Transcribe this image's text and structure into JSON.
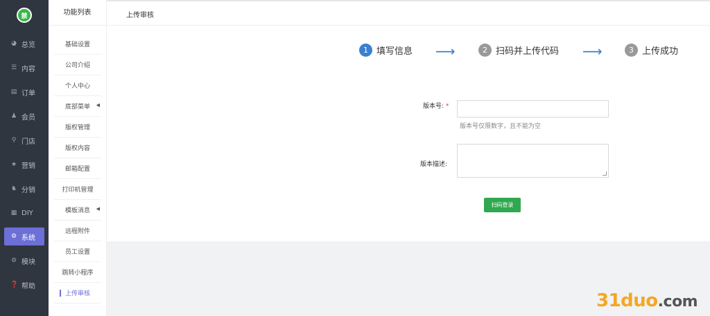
{
  "logo": {
    "text": "禁"
  },
  "nav": {
    "items": [
      {
        "label": "总览",
        "icon": "pie-chart-icon",
        "glyph": "◕"
      },
      {
        "label": "内容",
        "icon": "list-icon",
        "glyph": "☰"
      },
      {
        "label": "订单",
        "icon": "order-icon",
        "glyph": "▤"
      },
      {
        "label": "会员",
        "icon": "user-icon",
        "glyph": "♟"
      },
      {
        "label": "门店",
        "icon": "location-icon",
        "glyph": "⚲"
      },
      {
        "label": "营销",
        "icon": "star-icon",
        "glyph": "★"
      },
      {
        "label": "分销",
        "icon": "users-icon",
        "glyph": "♞"
      },
      {
        "label": "DIY",
        "icon": "layout-icon",
        "glyph": "▦"
      },
      {
        "label": "系统",
        "icon": "gear-icon",
        "glyph": "⚙",
        "active": true
      },
      {
        "label": "模块",
        "icon": "gear-icon",
        "glyph": "⚙"
      },
      {
        "label": "帮助",
        "icon": "help-icon",
        "glyph": "❓"
      }
    ]
  },
  "sub": {
    "title": "功能列表",
    "items": [
      {
        "label": "基础设置"
      },
      {
        "label": "公司介绍"
      },
      {
        "label": "个人中心"
      },
      {
        "label": "底部菜单",
        "caret": "◀"
      },
      {
        "label": "版权管理"
      },
      {
        "label": "版权内容"
      },
      {
        "label": "邮箱配置"
      },
      {
        "label": "打印机管理"
      },
      {
        "label": "模板消息",
        "caret": "◀"
      },
      {
        "label": "远程附件"
      },
      {
        "label": "员工设置"
      },
      {
        "label": "跳转小程序"
      },
      {
        "label": "上传审核",
        "active": true
      }
    ]
  },
  "header": {
    "title": "上传审核"
  },
  "steps": [
    {
      "num": "1",
      "label": "填写信息",
      "active": true
    },
    {
      "num": "2",
      "label": "扫码并上传代码"
    },
    {
      "num": "3",
      "label": "上传成功"
    }
  ],
  "arrow_glyph": "⟶",
  "form": {
    "version_label": "版本号:",
    "required_mark": "*",
    "version_value": "",
    "version_hint": "版本号仅限数字，且不能为空",
    "desc_label": "版本描述:",
    "desc_value": "",
    "submit_label": "扫码登录"
  },
  "watermark": {
    "main": "31duo",
    "suffix": ".com"
  },
  "colors": {
    "accent": "#6c6fd6",
    "step_active": "#3b7fd1",
    "submit": "#2fa84f",
    "nav_bg": "#2f3640"
  }
}
